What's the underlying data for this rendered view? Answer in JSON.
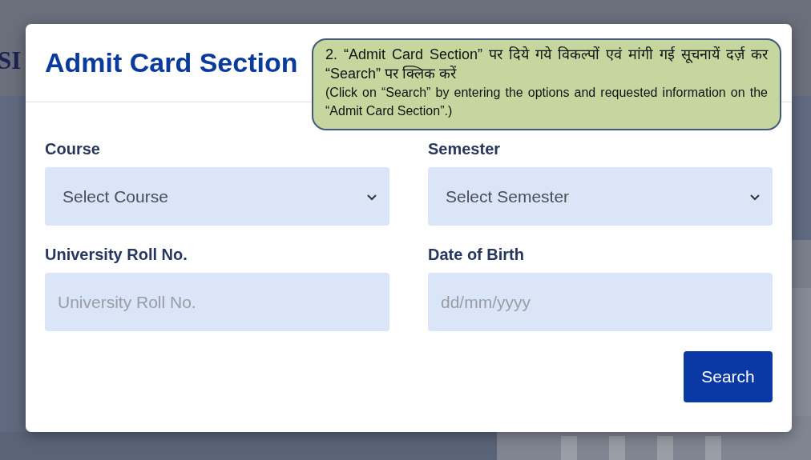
{
  "background": {
    "heading_fragment": "SI"
  },
  "dialog": {
    "title": "Admit Card Section",
    "fields": [
      {
        "kind": "select",
        "label": "Course",
        "value": "Select Course"
      },
      {
        "kind": "select",
        "label": "Semester",
        "value": "Select Semester"
      },
      {
        "kind": "input",
        "label": "University Roll No.",
        "placeholder": "University Roll No."
      },
      {
        "kind": "input",
        "label": "Date of Birth",
        "placeholder": "dd/mm/yyyy"
      }
    ],
    "button": "Search"
  },
  "callout": {
    "hindi": "2. “Admit Card Section” पर दिये गये विकल्पों एवं मांगी गई सूचनायें दर्ज़ कर “Search” पर क्लिक करें",
    "english": "(Click on “Search” by entering the options and requested information on the “Admit Card Section”.)"
  }
}
